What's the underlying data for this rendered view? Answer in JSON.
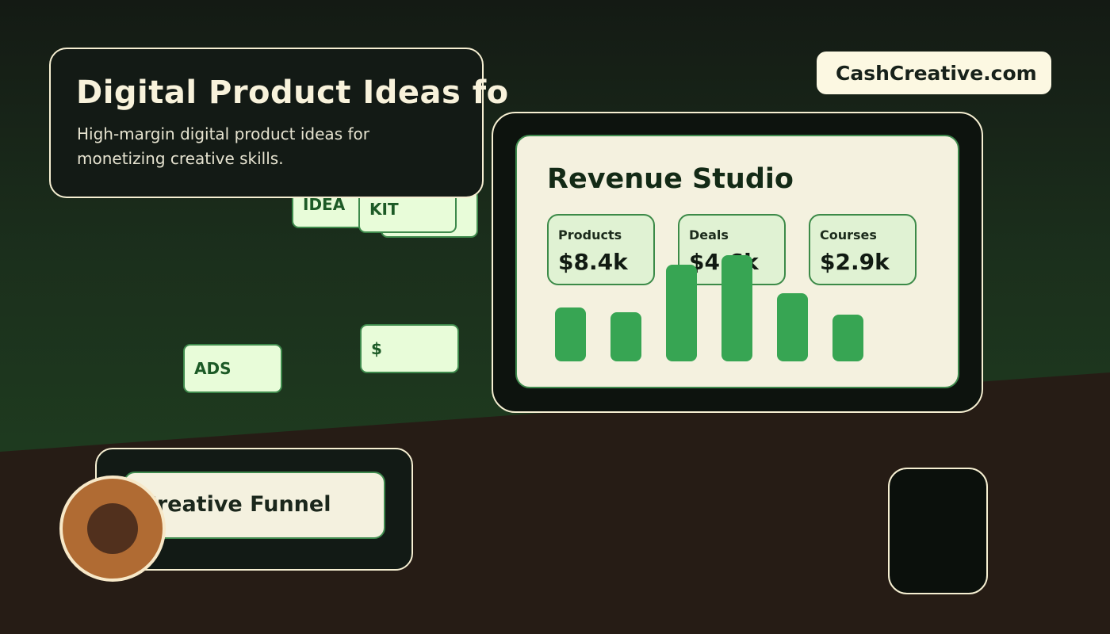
{
  "title_card": {
    "title": "Digital Product Ideas fo",
    "subtitle": "High-margin digital product ideas for monetizing creative skills."
  },
  "brand": {
    "label": "CashCreative.com"
  },
  "tags": {
    "idea": "IDEA",
    "kit": "KIT",
    "ads": "ADS",
    "dollar": "$"
  },
  "dashboard": {
    "title": "Revenue Studio",
    "stats": [
      {
        "label": "Products",
        "value": "$8.4k"
      },
      {
        "label": "Deals",
        "value": "$4.6k"
      },
      {
        "label": "Courses",
        "value": "$2.9k"
      }
    ],
    "bars": [
      0.51,
      0.46,
      0.91,
      1.0,
      0.64,
      0.44
    ]
  },
  "funnel": {
    "label": "Creative Funnel"
  },
  "colors": {
    "accent": "#37a553",
    "cream": "#f4f1df",
    "border": "#f6efd2"
  }
}
